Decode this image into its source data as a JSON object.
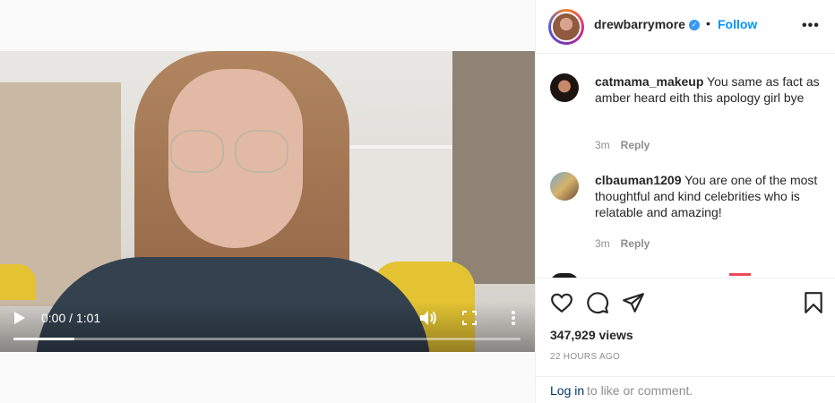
{
  "video": {
    "time": "0:00 / 1:01",
    "progress_fraction": 0.12
  },
  "header": {
    "username": "drewbarrymore",
    "separator": "•",
    "follow_label": "Follow",
    "more_icon": "more-horizontal-icon"
  },
  "comments": [
    {
      "username": "catmama_makeup",
      "text": "You same as fact as amber heard eith this apology girl bye",
      "time": "3m",
      "reply_label": "Reply"
    },
    {
      "username": "clbauman1209",
      "text": "You are one of the most thoughtful and kind celebrities who is relatable and amazing!",
      "time": "3m",
      "reply_label": "Reply"
    }
  ],
  "actions": {
    "views": "347,929 views",
    "posted": "22 HOURS AGO"
  },
  "login": {
    "link_label": "Log in",
    "rest_text": "to like or comment."
  },
  "colors": {
    "accent": "#0095f6",
    "verified": "#3897f0",
    "muted": "#8e8e8e"
  }
}
